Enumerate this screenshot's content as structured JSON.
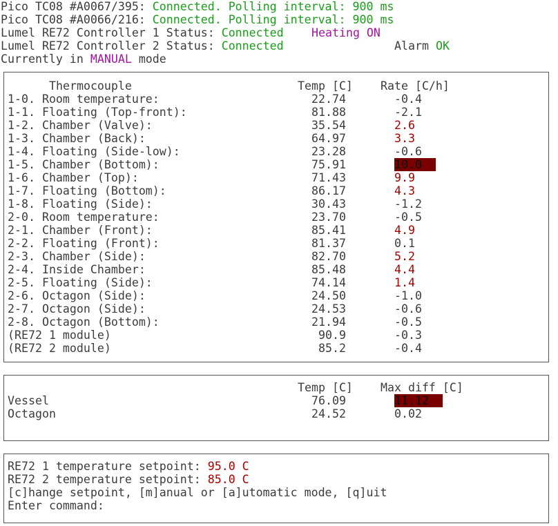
{
  "status": {
    "pico1": {
      "label": "Pico TC08 #A0067/395: ",
      "state": "Connected. Polling interval: 900 ms"
    },
    "pico2": {
      "label": "Pico TC08 #A0066/216: ",
      "state": "Connected. Polling interval: 900 ms"
    },
    "re72_1": {
      "label": "Lumel RE72 Controller 1 Status: ",
      "state": "Connected",
      "extra": "Heating ON"
    },
    "re72_2": {
      "label": "Lumel RE72 Controller 2 Status: ",
      "state": "Connected",
      "extra_label": "Alarm ",
      "extra_value": "OK"
    },
    "mode": {
      "prefix": "Currently in ",
      "value": "MANUAL",
      "suffix": " mode"
    }
  },
  "thermo": {
    "headers": {
      "name": "Thermocouple",
      "temp": "Temp [C]",
      "rate": "Rate [C/h]"
    },
    "rows": [
      {
        "name": "1-0. Room temperature:",
        "temp": "22.74",
        "rate": "-0.4",
        "style": "normal"
      },
      {
        "name": "1-1. Floating (Top-front):",
        "temp": "81.88",
        "rate": "-2.1",
        "style": "normal"
      },
      {
        "name": "1-2. Chamber (Valve):",
        "temp": "35.54",
        "rate": "2.6",
        "style": "red"
      },
      {
        "name": "1-3. Chamber (Back):",
        "temp": "64.97",
        "rate": "3.3",
        "style": "red"
      },
      {
        "name": "1-4. Floating (Side-low):",
        "temp": "23.28",
        "rate": "-0.6",
        "style": "normal"
      },
      {
        "name": "1-5. Chamber (Bottom):",
        "temp": "75.91",
        "rate": "10.0",
        "style": "alert"
      },
      {
        "name": "1-6. Chamber (Top):",
        "temp": "71.43",
        "rate": "9.9",
        "style": "red"
      },
      {
        "name": "1-7. Floating (Bottom):",
        "temp": "86.17",
        "rate": "4.3",
        "style": "red"
      },
      {
        "name": "1-8. Floating (Side):",
        "temp": "30.43",
        "rate": "-1.2",
        "style": "normal"
      },
      {
        "name": "2-0. Room temperature:",
        "temp": "23.70",
        "rate": "-0.5",
        "style": "normal"
      },
      {
        "name": "2-1. Chamber (Front):",
        "temp": "85.41",
        "rate": "4.9",
        "style": "red"
      },
      {
        "name": "2-2. Floating (Front):",
        "temp": "81.37",
        "rate": "0.1",
        "style": "normal"
      },
      {
        "name": "2-3. Chamber (Side):",
        "temp": "82.70",
        "rate": "5.2",
        "style": "red"
      },
      {
        "name": "2-4. Inside Chamber:",
        "temp": "85.48",
        "rate": "4.4",
        "style": "red"
      },
      {
        "name": "2-5. Floating (Side):",
        "temp": "74.14",
        "rate": "1.4",
        "style": "red"
      },
      {
        "name": "2-6. Octagon (Side):",
        "temp": "24.50",
        "rate": "-1.0",
        "style": "normal"
      },
      {
        "name": "2-7. Octagon (Side):",
        "temp": "24.53",
        "rate": "-0.6",
        "style": "normal"
      },
      {
        "name": "2-8. Octagon (Bottom):",
        "temp": "21.94",
        "rate": "-0.5",
        "style": "normal"
      },
      {
        "name": "(RE72 1 module)",
        "temp": "90.9",
        "rate": "-0.3",
        "style": "normal"
      },
      {
        "name": "(RE72 2 module)",
        "temp": "85.2",
        "rate": "-0.4",
        "style": "normal"
      }
    ]
  },
  "summary": {
    "headers": {
      "temp": "Temp [C]",
      "diff": "Max diff [C]"
    },
    "rows": [
      {
        "name": "Vessel",
        "temp": "76.09",
        "diff": "11.12",
        "style": "alert"
      },
      {
        "name": "Octagon",
        "temp": "24.52",
        "diff": "0.02",
        "style": "normal"
      }
    ]
  },
  "control": {
    "sp1_label": "RE72 1 temperature setpoint: ",
    "sp1_value": "95.0 C",
    "sp2_label": "RE72 2 temperature setpoint: ",
    "sp2_value": "85.0 C",
    "help": "[c]hange setpoint, [m]anual or [a]utomatic mode, [q]uit",
    "prompt": "Enter command:"
  },
  "colors": {
    "green": "#1f9a1f",
    "purple": "#a0179a",
    "red": "#a80000",
    "alert_bg": "#7a0000"
  }
}
